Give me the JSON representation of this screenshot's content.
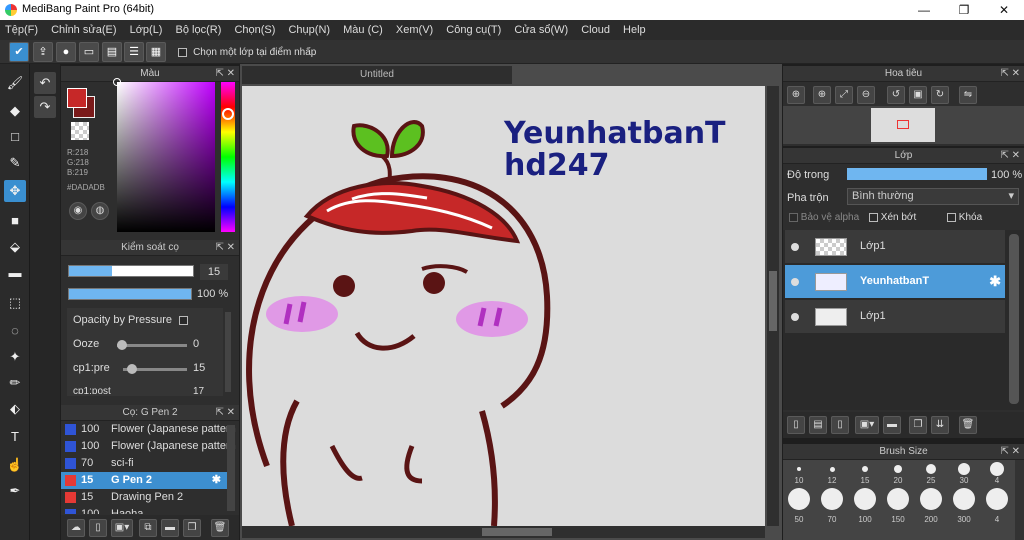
{
  "window": {
    "title": "MediBang Paint Pro (64bit)",
    "min": "—",
    "max": "❐",
    "close": "✕"
  },
  "menu": [
    "Tệp(F)",
    "Chỉnh sửa(E)",
    "Lớp(L)",
    "Bộ lọc(R)",
    "Chọn(S)",
    "Chụp(N)",
    "Màu (C)",
    "Xem(V)",
    "Công cụ(T)",
    "Cửa sổ(W)",
    "Cloud",
    "Help"
  ],
  "toolbar": {
    "option_label": "Chọn một lớp tại điểm nhấp"
  },
  "color_panel": {
    "title": "Màu",
    "r": "R:218",
    "g": "G:218",
    "b": "B:219",
    "hex": "#DADADB",
    "primary": "#c62828",
    "secondary": "#7a1a1a"
  },
  "brush_control": {
    "title": "Kiểm soát cọ",
    "size": "15",
    "size_fill": 0.35,
    "opacity": "100 %",
    "opacity_fill": 1.0,
    "opacity_pressure": "Opacity by Pressure",
    "ooze_label": "Ooze",
    "ooze_value": "0",
    "cp1_label": "cp1:pre",
    "cp1_value": "15",
    "cut_label": "cp1:post",
    "cut_value": "17"
  },
  "brush_list": {
    "title": "Cọ: G Pen 2",
    "items": [
      {
        "size": "100",
        "name": "Flower (Japanese pattern",
        "color": "#2f54d6"
      },
      {
        "size": "100",
        "name": "Flower (Japanese pattern",
        "color": "#2f54d6"
      },
      {
        "size": "70",
        "name": "sci-fi",
        "color": "#2f54d6"
      },
      {
        "size": "15",
        "name": "G Pen 2",
        "color": "#e53935"
      },
      {
        "size": "15",
        "name": "Drawing Pen 2",
        "color": "#e53935"
      },
      {
        "size": "100",
        "name": "Haoha",
        "color": "#2f54d6"
      }
    ]
  },
  "document": {
    "tab": "Untitled",
    "canvas_text_1": "YeunhatbanT",
    "canvas_text_2": "hd247"
  },
  "navigator": {
    "title": "Hoa tiêu"
  },
  "layers": {
    "title": "Lớp",
    "opacity_label": "Độ trong",
    "opacity_value": "100 %",
    "blend_label": "Pha trộn",
    "blend_value": "Bình thường",
    "protect_alpha": "Bảo vệ alpha",
    "clipping": "Xén bớt",
    "lock": "Khóa",
    "items": [
      {
        "name": "Lớp1"
      },
      {
        "name": "YeunhatbanT"
      },
      {
        "name": "Lớp1"
      }
    ]
  },
  "brush_size": {
    "title": "Brush Size",
    "row1": [
      "10",
      "12",
      "15",
      "20",
      "25",
      "30",
      "4"
    ],
    "row2": [
      "50",
      "70",
      "100",
      "150",
      "200",
      "300",
      "4"
    ]
  }
}
